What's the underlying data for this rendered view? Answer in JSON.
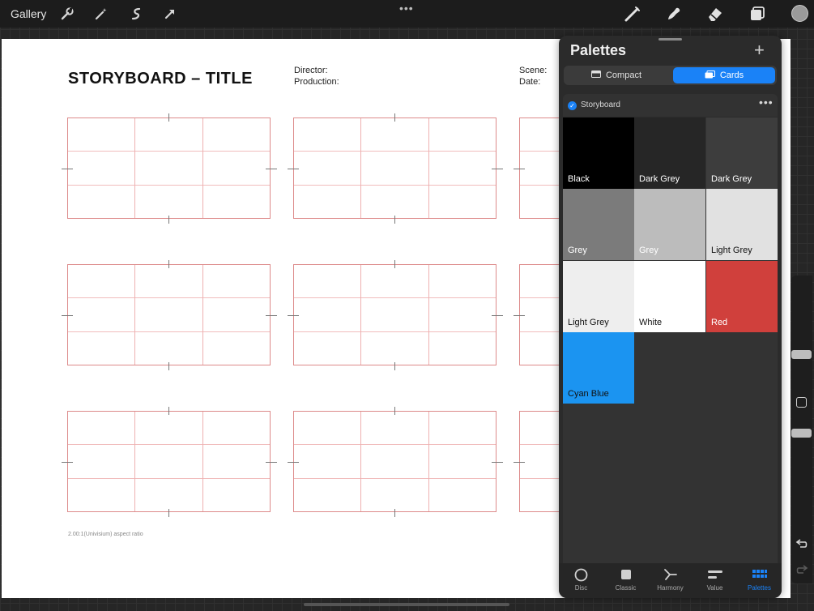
{
  "toolbar": {
    "gallery_label": "Gallery",
    "left_tools": [
      "wrench-icon",
      "magic-wand-icon",
      "selection-icon",
      "transform-icon"
    ],
    "right_tools": [
      "brush-icon",
      "smudge-icon",
      "eraser-icon",
      "layers-icon"
    ],
    "more_label": "•••",
    "current_color": "#9a9a9a"
  },
  "canvas": {
    "title": "STORYBOARD – TITLE",
    "director_label": "Director:",
    "production_label": "Production:",
    "scene_label": "Scene:",
    "date_label": "Date:",
    "aspect_note": "2.00:1(Univisium) aspect ratio",
    "frame_color": "#dd8a8a"
  },
  "palettes": {
    "title": "Palettes",
    "add_label": "+",
    "view_modes": [
      {
        "label": "Compact",
        "active": false
      },
      {
        "label": "Cards",
        "active": true
      }
    ],
    "palette_name": "Storyboard",
    "palette_more": "•••",
    "swatches": [
      {
        "name": "Black",
        "color": "#000000",
        "text_color": "#ffffff"
      },
      {
        "name": "Dark Grey",
        "color": "#262626",
        "text_color": "#ffffff"
      },
      {
        "name": "Dark Grey",
        "color": "#3d3d3d",
        "text_color": "#ffffff"
      },
      {
        "name": "Grey",
        "color": "#7b7b7b",
        "text_color": "#ffffff"
      },
      {
        "name": "Grey",
        "color": "#bcbcbc",
        "text_color": "#ffffff"
      },
      {
        "name": "Light Grey",
        "color": "#e1e1e1",
        "text_color": "#111111"
      },
      {
        "name": "Light Grey",
        "color": "#eeeeee",
        "text_color": "#111111"
      },
      {
        "name": "White",
        "color": "#ffffff",
        "text_color": "#111111"
      },
      {
        "name": "Red",
        "color": "#d0403c",
        "text_color": "#ffffff"
      },
      {
        "name": "Cyan Blue",
        "color": "#1b94f1",
        "text_color": "#111111"
      }
    ],
    "tabs": [
      {
        "label": "Disc",
        "icon": "disc-icon",
        "active": false
      },
      {
        "label": "Classic",
        "icon": "classic-icon",
        "active": false
      },
      {
        "label": "Harmony",
        "icon": "harmony-icon",
        "active": false
      },
      {
        "label": "Value",
        "icon": "value-icon",
        "active": false
      },
      {
        "label": "Palettes",
        "icon": "palettes-icon",
        "active": true
      }
    ],
    "accent": "#1a82f7"
  },
  "sidebar": {
    "undo_icon": "undo-icon",
    "redo_icon": "redo-icon"
  }
}
